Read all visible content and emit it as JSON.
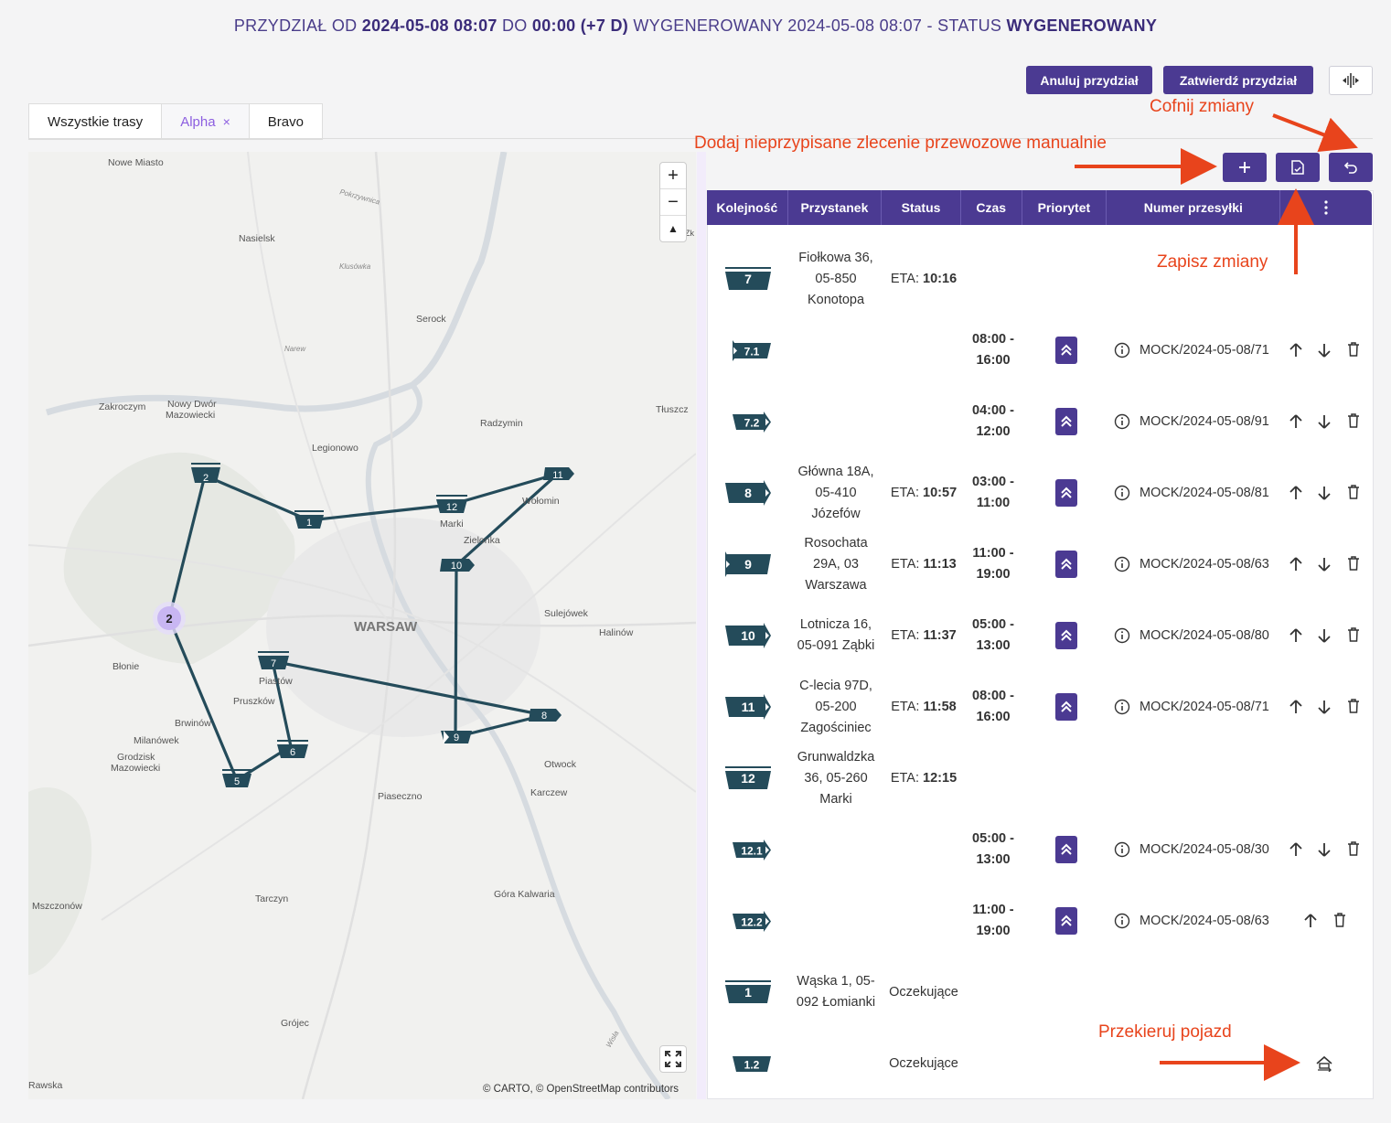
{
  "header": {
    "p1": "PRZYDZIAŁ OD ",
    "from": "2024-05-08 08:07",
    "p2": " DO ",
    "to": "00:00 (+7 D)",
    "p3": " WYGENEROWANY 2024-05-08 08:07 - STATUS ",
    "status": "WYGENEROWANY"
  },
  "toolbar": {
    "cancel_label": "Anuluj przydział",
    "confirm_label": "Zatwierdź przydział"
  },
  "tabs": [
    {
      "label": "Wszystkie trasy"
    },
    {
      "label": "Alpha",
      "close": "×"
    },
    {
      "label": "Bravo"
    }
  ],
  "map": {
    "places": [
      {
        "name": "Nowe Miasto"
      },
      {
        "name": "Pokrzywnica"
      },
      {
        "name": "Nasielsk"
      },
      {
        "name": "Klusówka"
      },
      {
        "name": "Serock"
      },
      {
        "name": "Narew"
      },
      {
        "name": "Zakroczym"
      },
      {
        "name": "Nowy Dwór"
      },
      {
        "name": "Mazowiecki"
      },
      {
        "name": "Radzymin"
      },
      {
        "name": "Tłuszcz"
      },
      {
        "name": "Legionowo"
      },
      {
        "name": "Marki"
      },
      {
        "name": "Wołomin"
      },
      {
        "name": "Zielonka"
      },
      {
        "name": "WARSAW"
      },
      {
        "name": "Sulejówek"
      },
      {
        "name": "Halinów"
      },
      {
        "name": "Błonie"
      },
      {
        "name": "Piastów"
      },
      {
        "name": "Pruszków"
      },
      {
        "name": "Brwinów"
      },
      {
        "name": "Milanówek"
      },
      {
        "name": "Grodzisk"
      },
      {
        "name": "Mazowiecki"
      },
      {
        "name": "Otwock"
      },
      {
        "name": "Karczew"
      },
      {
        "name": "Piaseczno"
      },
      {
        "name": "Tarczyn"
      },
      {
        "name": "Góra Kalwaria"
      },
      {
        "name": "Mszczonów"
      },
      {
        "name": "Grójec"
      },
      {
        "name": "Rawska"
      },
      {
        "name": "Wisła"
      },
      {
        "name": "Zk"
      }
    ],
    "markers": [
      {
        "label": "2"
      },
      {
        "label": "1"
      },
      {
        "label": "12"
      },
      {
        "label": "11"
      },
      {
        "label": "10"
      },
      {
        "label": "7"
      },
      {
        "label": "8"
      },
      {
        "label": "9"
      },
      {
        "label": "6"
      },
      {
        "label": "5"
      }
    ],
    "cluster": "2",
    "zoom_in": "+",
    "zoom_out": "−",
    "compass": "▲",
    "attribution": "© CARTO, © OpenStreetMap contributors"
  },
  "annotations": {
    "cofnij": "Cofnij zmiany",
    "dodaj": "Dodaj nieprzypisane zlecenie przewozowe manualnie",
    "zapisz": "Zapisz zmiany",
    "przekieruj": "Przekieruj pojazd"
  },
  "table": {
    "headers": [
      "Kolejność",
      "Przystanek",
      "Status",
      "Czas",
      "Priorytet",
      "Numer przesyłki"
    ],
    "rows": [
      {
        "seq": "7",
        "kind": "stop",
        "address": [
          "Fiołkowa 36,",
          "05-850",
          "Konotopa"
        ],
        "status": "ETA: ",
        "eta": "10:16",
        "time": [],
        "prio": false,
        "shipment": "",
        "actions": ""
      },
      {
        "seq": "7.1",
        "kind": "sub-left",
        "address": [],
        "status": "",
        "eta": "",
        "time": [
          "08:00 -",
          "16:00"
        ],
        "prio": true,
        "shipment": "MOCK/2024-05-08/71",
        "actions": "full"
      },
      {
        "seq": "7.2",
        "kind": "sub-right",
        "address": [],
        "status": "",
        "eta": "",
        "time": [
          "04:00 -",
          "12:00"
        ],
        "prio": true,
        "shipment": "MOCK/2024-05-08/91",
        "actions": "full"
      },
      {
        "seq": "8",
        "kind": "stop-right",
        "address": [
          "Główna 18A,",
          "05-410",
          "Józefów"
        ],
        "status": "ETA: ",
        "eta": "10:57",
        "time": [
          "03:00 -",
          "11:00"
        ],
        "prio": true,
        "shipment": "MOCK/2024-05-08/81",
        "actions": "full"
      },
      {
        "seq": "9",
        "kind": "stop-left",
        "address": [
          "Rosochata",
          "29A, 03",
          "Warszawa"
        ],
        "status": "ETA: ",
        "eta": "11:13",
        "time": [
          "11:00 -",
          "19:00"
        ],
        "prio": true,
        "shipment": "MOCK/2024-05-08/63",
        "actions": "full"
      },
      {
        "seq": "10",
        "kind": "stop-right",
        "address": [
          "Lotnicza 16,",
          "05-091 Ząbki"
        ],
        "status": "ETA: ",
        "eta": "11:37",
        "time": [
          "05:00 -",
          "13:00"
        ],
        "prio": true,
        "shipment": "MOCK/2024-05-08/80",
        "actions": "full"
      },
      {
        "seq": "11",
        "kind": "stop-right",
        "address": [
          "C-lecia 97D,",
          "05-200",
          "Zagościniec"
        ],
        "status": "ETA: ",
        "eta": "11:58",
        "time": [
          "08:00 -",
          "16:00"
        ],
        "prio": true,
        "shipment": "MOCK/2024-05-08/71",
        "actions": "full"
      },
      {
        "seq": "12",
        "kind": "stop",
        "address": [
          "Grunwaldzka",
          "36, 05-260",
          "Marki"
        ],
        "status": "ETA: ",
        "eta": "12:15",
        "time": [],
        "prio": false,
        "shipment": "",
        "actions": ""
      },
      {
        "seq": "12.1",
        "kind": "sub-right",
        "address": [],
        "status": "",
        "eta": "",
        "time": [
          "05:00 -",
          "13:00"
        ],
        "prio": true,
        "shipment": "MOCK/2024-05-08/30",
        "actions": "full"
      },
      {
        "seq": "12.2",
        "kind": "sub-right",
        "address": [],
        "status": "",
        "eta": "",
        "time": [
          "11:00 -",
          "19:00"
        ],
        "prio": true,
        "shipment": "MOCK/2024-05-08/63",
        "actions": "up-delete"
      },
      {
        "seq": "1",
        "kind": "stop",
        "address": [
          "Wąska 1, 05-",
          "092 Łomianki"
        ],
        "status": "Oczekujące",
        "eta": "",
        "time": [],
        "prio": false,
        "shipment": "",
        "actions": ""
      },
      {
        "seq": "1.2",
        "kind": "sub",
        "address": [],
        "status": "Oczekujące",
        "eta": "",
        "time": [],
        "prio": false,
        "shipment": "",
        "actions": "redirect"
      }
    ]
  },
  "colors": {
    "accent": "#4b3a92",
    "marker": "#244b5a",
    "annotation": "#e8441c",
    "cluster": "#c8b6f2"
  }
}
